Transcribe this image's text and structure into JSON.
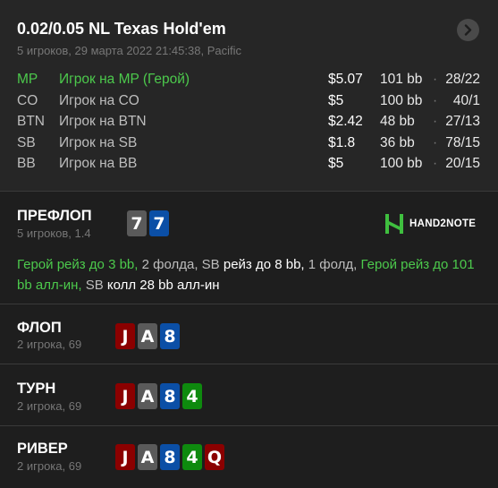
{
  "header": {
    "title": "0.02/0.05 NL Texas Hold'em",
    "subtitle": "5 игроков, 29 марта 2022 21:45:38, Pacific",
    "next_icon": "chevron-right-icon"
  },
  "colors": {
    "hero_green": "#4cc94c",
    "card_red": "#8b0000",
    "card_gray": "#5a5a5a",
    "card_blue": "#0b4fa6",
    "card_green": "#0e8a0e",
    "brand_green": "#3fbf3f"
  },
  "players": [
    {
      "pos": "MP",
      "name": "Игрок на MP (Герой)",
      "stack": "$5.07",
      "bb": "101 bb",
      "stats": "28/22",
      "hero": true
    },
    {
      "pos": "CO",
      "name": "Игрок на CO",
      "stack": "$5",
      "bb": "100 bb",
      "stats": "40/1",
      "hero": false
    },
    {
      "pos": "BTN",
      "name": "Игрок на BTN",
      "stack": "$2.42",
      "bb": "48 bb",
      "stats": "27/13",
      "hero": false
    },
    {
      "pos": "SB",
      "name": "Игрок на SB",
      "stack": "$1.8",
      "bb": "36 bb",
      "stats": "78/15",
      "hero": false
    },
    {
      "pos": "BB",
      "name": "Игрок на BB",
      "stack": "$5",
      "bb": "100 bb",
      "stats": "20/15",
      "hero": false
    }
  ],
  "separator": "·",
  "brand": {
    "text": "HAND2NOTE",
    "logo_icon": "hand2note-logo-icon"
  },
  "preflop": {
    "name": "ПРЕФЛОП",
    "sub": "5 игроков, 1.4",
    "cards": [
      {
        "rank": "7",
        "suit": "clubs-gray"
      },
      {
        "rank": "7",
        "suit": "diamonds-blue"
      }
    ],
    "actions": [
      {
        "text": "Герой рейз до 3 bb,",
        "kind": "hero"
      },
      {
        "text": "2 фолда,",
        "kind": "muted"
      },
      {
        "text": "SB",
        "kind": "muted"
      },
      {
        "text": "рейз до 8 bb,",
        "kind": "opp"
      },
      {
        "text": "1 фолд,",
        "kind": "muted"
      },
      {
        "text": "Герой рейз до 101 bb алл-ин,",
        "kind": "hero"
      },
      {
        "text": "SB",
        "kind": "muted"
      },
      {
        "text": "колл 28 bb алл-ин",
        "kind": "opp"
      }
    ]
  },
  "flop": {
    "name": "ФЛОП",
    "sub": "2 игрока, 69",
    "cards": [
      {
        "rank": "J",
        "suit": "red"
      },
      {
        "rank": "A",
        "suit": "gray"
      },
      {
        "rank": "8",
        "suit": "blue"
      }
    ]
  },
  "turn": {
    "name": "ТУРН",
    "sub": "2 игрока, 69",
    "cards": [
      {
        "rank": "J",
        "suit": "red"
      },
      {
        "rank": "A",
        "suit": "gray"
      },
      {
        "rank": "8",
        "suit": "blue"
      },
      {
        "rank": "4",
        "suit": "green"
      }
    ]
  },
  "river": {
    "name": "РИВЕР",
    "sub": "2 игрока, 69",
    "cards": [
      {
        "rank": "J",
        "suit": "red"
      },
      {
        "rank": "A",
        "suit": "gray"
      },
      {
        "rank": "8",
        "suit": "blue"
      },
      {
        "rank": "4",
        "suit": "green"
      },
      {
        "rank": "Q",
        "suit": "red"
      }
    ]
  }
}
